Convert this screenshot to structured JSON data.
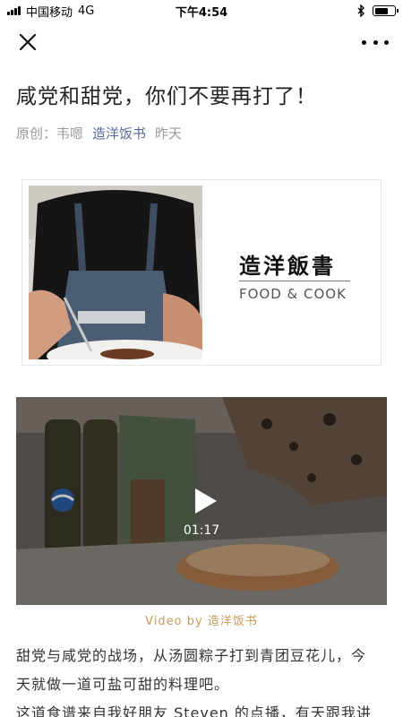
{
  "status_bar": {
    "carrier": "中国移动",
    "network": "4G",
    "time": "下午4:54",
    "bluetooth_icon": "bluetooth-icon",
    "battery_level": 0.7
  },
  "nav": {
    "close_icon": "close-icon",
    "more_icon": "more-icon"
  },
  "article": {
    "title": "咸党和甜党，你们不要再打了！",
    "original_label": "原创：",
    "author": "韦嗯",
    "account": "造洋饭书",
    "date": "昨天"
  },
  "cover": {
    "brand_cn": "造洋飯書",
    "brand_en": "FOOD & COOK"
  },
  "video": {
    "duration": "01:17",
    "caption_prefix": "Video by",
    "caption_name": "造洋饭书"
  },
  "body": {
    "line1": "甜党与咸党的战场，从汤圆粽子打到青团豆花儿，今",
    "line2": "天就做一道可盐可甜的料理吧。",
    "line3": "这道食谱来自我好朋友 Steven 的点播，有天跟我讲"
  },
  "colors": {
    "account_link": "#586c94",
    "caption_accent": "#c79a5c",
    "meta_gray": "#9a9a9a"
  }
}
